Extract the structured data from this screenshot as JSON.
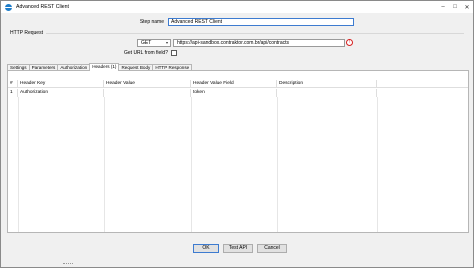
{
  "window": {
    "title": "Advanced REST Client",
    "minimize": "–",
    "maximize": "□",
    "close": "✕"
  },
  "step": {
    "label": "Step name",
    "value": "Advanced REST Client"
  },
  "http_request": {
    "group_label": "HTTP Request",
    "method": "GET",
    "url": "https://api-sandbox.contraktor.com.br/api/contracts",
    "url_from_field_label": "Get URL from field?",
    "url_from_field_checked": false
  },
  "tabs": [
    {
      "label": "Settings",
      "active": false
    },
    {
      "label": "Parameters",
      "active": false
    },
    {
      "label": "Authorization",
      "active": false
    },
    {
      "label": "Headers (1)",
      "active": true
    },
    {
      "label": "Request Body",
      "active": false
    },
    {
      "label": "HTTP Response",
      "active": false
    }
  ],
  "headers_table": {
    "columns": [
      "#",
      "Header Key",
      "Header Value",
      "Header Value Field",
      "Description",
      ""
    ],
    "rows": [
      [
        "1",
        "Authorization",
        "",
        "token",
        "",
        ""
      ]
    ]
  },
  "buttons": {
    "ok": "OK",
    "test_api": "Test API",
    "cancel": "Cancel"
  },
  "colors": {
    "focus_border": "#3d7bd0",
    "warning": "#d62020",
    "app_icon": "#1e7cc8"
  }
}
